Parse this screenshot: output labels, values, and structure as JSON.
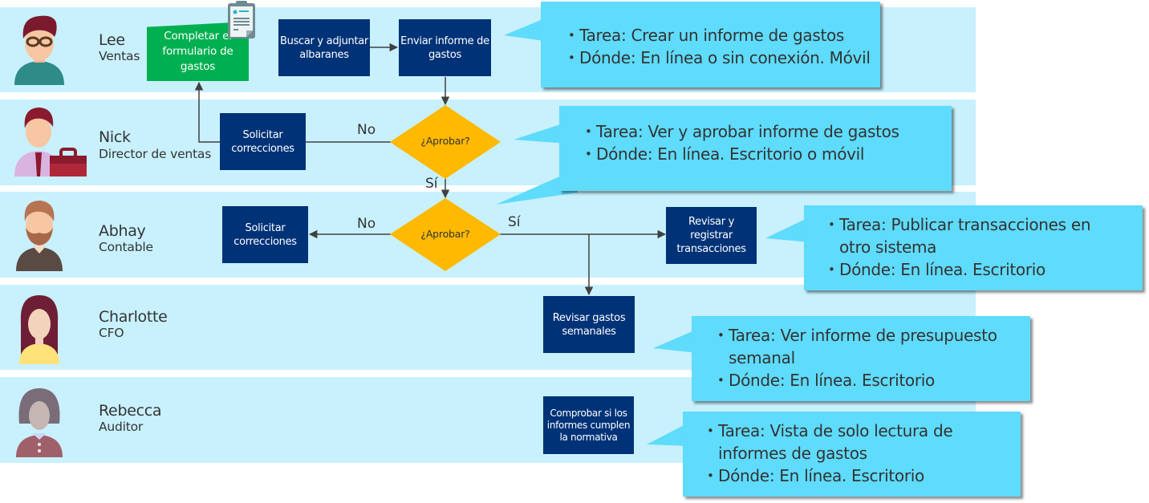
{
  "colors": {
    "lane_bg": "#c8f1fd",
    "process_box": "#003277",
    "start_box": "#00b050",
    "decision": "#ffb900",
    "callout": "#5fdbfc",
    "connector": "#404040"
  },
  "lanes": [
    {
      "name": "Lee",
      "role": "Ventas",
      "avatar_icon": "man-glasses-avatar-icon"
    },
    {
      "name": "Nick",
      "role": "Director de ventas",
      "avatar_icon": "man-briefcase-avatar-icon"
    },
    {
      "name": "Abhay",
      "role": "Contable",
      "avatar_icon": "bearded-man-avatar-icon"
    },
    {
      "name": "Charlotte",
      "role": "CFO",
      "avatar_icon": "woman-long-hair-avatar-icon"
    },
    {
      "name": "Rebecca",
      "role": "Auditor",
      "avatar_icon": "woman-bob-hair-avatar-icon"
    }
  ],
  "nodes": {
    "complete_form": "Completar el formulario de gastos",
    "form_icon": "clipboard-form-icon",
    "find_receipts": "Buscar y adjuntar albaranes",
    "submit_report": "Enviar informe de gastos",
    "nick_request_corrections": "Solicitar correcciones",
    "nick_approve": "¿Aprobar?",
    "abhay_request_corrections": "Solicitar correcciones",
    "abhay_approve": "¿Aprobar?",
    "review_transactions": "Revisar y registrar transacciones",
    "review_weekly": "Revisar gastos semanales",
    "check_compliance": "Comprobar si los informes cumplen la normativa"
  },
  "flow_labels": {
    "nick_no": "No",
    "nick_yes": "Sí",
    "abhay_no": "No",
    "abhay_yes": "Sí"
  },
  "callouts": [
    {
      "lines": [
        "Tarea: Crear un informe de gastos",
        "Dónde: En línea o sin conexión. Móvil"
      ]
    },
    {
      "lines": [
        "Tarea: Ver y aprobar informe de gastos",
        "Dónde: En línea. Escritorio o móvil"
      ]
    },
    {
      "lines": [
        "Tarea: Publicar transacciones en otro sistema",
        "Dónde: En línea. Escritorio"
      ]
    },
    {
      "lines": [
        "Tarea: Ver informe de presupuesto semanal",
        "Dónde: En línea. Escritorio"
      ]
    },
    {
      "lines": [
        "Tarea: Vista de solo lectura de informes de gastos",
        "Dónde: En línea. Escritorio"
      ]
    }
  ]
}
